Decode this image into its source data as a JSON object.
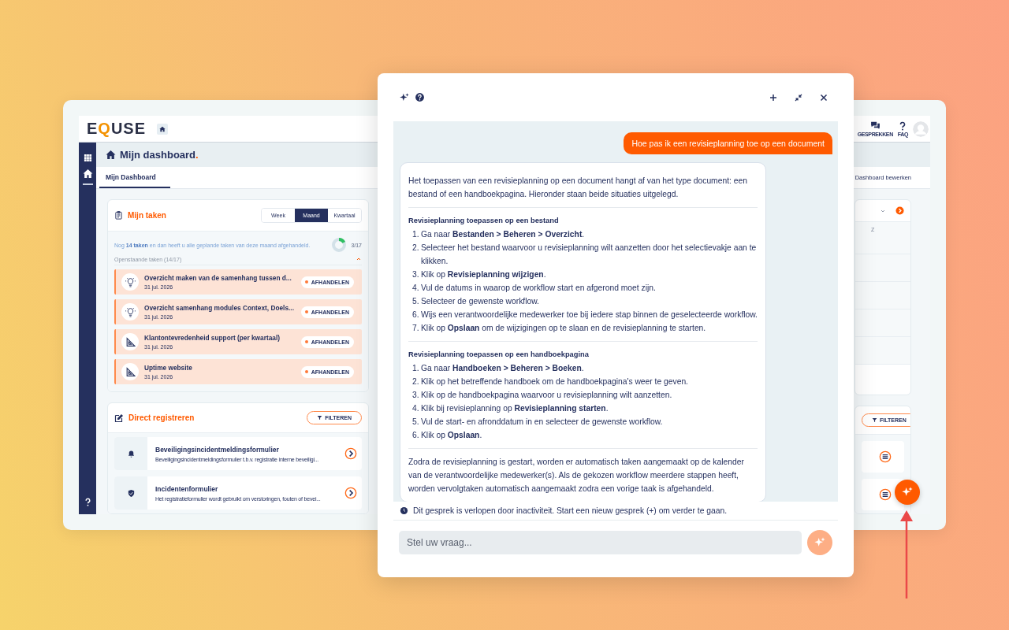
{
  "dashboard": {
    "logo": "EQUSE",
    "header_links": [
      {
        "kind": "chat",
        "label": "GESPREKKEN"
      },
      {
        "kind": "question",
        "label": "FAQ"
      }
    ],
    "page_title": {
      "text": "Mijn dashboard",
      "mark": "."
    },
    "tabs": [
      {
        "label": "Mijn Dashboard",
        "selected": true
      }
    ],
    "edit_link": "Dashboard bewerken",
    "tasks_card": {
      "title": "Mijn taken",
      "periods": [
        {
          "label": "Week",
          "selected": false
        },
        {
          "label": "Maand",
          "selected": true
        },
        {
          "label": "Kwartaal",
          "selected": false
        }
      ],
      "summary": "Nog **14 taken** en dan heeft u alle geplande taken van deze maand afgehandeld.",
      "progress": {
        "level": 0.176,
        "label": "3/17"
      },
      "open_tasks": {
        "label": "Openstaande taken (14/17)",
        "expanded": true
      },
      "tasks": [
        {
          "kind": "bulb",
          "title": "Overzicht maken van de samenhang tussen d...",
          "date": "31 jul. 2026",
          "action": "AFHANDELEN"
        },
        {
          "kind": "bulb",
          "title": "Overzicht samenhang modules Context, Doels...",
          "date": "31 jul. 2026",
          "action": "AFHANDELEN"
        },
        {
          "kind": "ruler",
          "title": "Klantontevredenheid support (per kwartaal)",
          "date": "31 jul. 2026",
          "action": "AFHANDELEN"
        },
        {
          "kind": "ruler",
          "title": "Uptime website",
          "date": "31 jul. 2026",
          "action": "AFHANDELEN"
        }
      ]
    },
    "register_card": {
      "title": "Direct registreren",
      "filter": "FILTEREN",
      "forms": [
        {
          "kind": "bell",
          "title": "Beveiligingsincidentmeldingsformulier",
          "description": "Beveiligingsincidentmeldingsformulier t.b.v. registratie interne beveiligi..."
        },
        {
          "kind": "shield",
          "title": "Incidentenformulier",
          "description": "Het registratieformulier wordt gebruikt om verstoringen, fouten of bevei..."
        }
      ]
    },
    "calendar_card": {
      "column_header": "Z"
    },
    "list_card": {
      "filter": "FILTEREN"
    }
  },
  "chat": {
    "user_message": "Hoe pas ik een revisieplanning toe op een document",
    "answer": [
      {
        "kind": "paragraph",
        "text": "Het toepassen van een revisieplanning op een document hangt af van het type document: een bestand of een handboekpagina. Hieronder staan beide situaties uitgelegd."
      },
      {
        "kind": "section",
        "heading": "Revisieplanning toepassen op een bestand",
        "steps": [
          {
            "number": "1.",
            "text": "Ga naar **Bestanden > Beheren > Overzicht**."
          },
          {
            "number": "2.",
            "text": "Selecteer het bestand waarvoor u revisieplanning wilt aanzetten door het selectievakje aan te klikken."
          },
          {
            "number": "3.",
            "text": "Klik op **Revisieplanning wijzigen**."
          },
          {
            "number": "4.",
            "text": "Vul de datums in waarop de workflow start en afgerond moet zijn."
          },
          {
            "number": "5.",
            "text": "Selecteer de gewenste workflow."
          },
          {
            "number": "6.",
            "text": "Wijs een verantwoordelijke medewerker toe bij iedere stap binnen de geselecteerde workflow."
          },
          {
            "number": "7.",
            "text": "Klik op **Opslaan** om de wijzigingen op te slaan en de revisieplanning te starten."
          }
        ]
      },
      {
        "kind": "section",
        "heading": "Revisieplanning toepassen op een handboekpagina",
        "steps": [
          {
            "number": "1.",
            "text": "Ga naar **Handboeken > Beheren > Boeken**."
          },
          {
            "number": "2.",
            "text": "Klik op het betreffende handboek om de handboekpagina's weer te geven."
          },
          {
            "number": "3.",
            "text": "Klik op de handboekpagina waarvoor u revisieplanning wilt aanzetten."
          },
          {
            "number": "4.",
            "text": "Klik bij revisieplanning op **Revisieplanning starten**."
          },
          {
            "number": "5.",
            "text": "Vul de start- en afronddatum in en selecteer de gewenste workflow."
          },
          {
            "number": "6.",
            "text": "Klik op **Opslaan**."
          }
        ]
      },
      {
        "kind": "paragraph",
        "text": "Zodra de revisieplanning is gestart, worden er automatisch taken aangemaakt op de kalender van de verantwoordelijke medewerker(s). Als de gekozen workflow meerdere stappen heeft, worden vervolgtaken automatisch aangemaakt zodra een vorige taak is afgehandeld."
      }
    ],
    "notice": "Dit gesprek is verlopen door inactiviteit. Start een nieuw gesprek (+) om verder te gaan.",
    "input": {
      "placeholder": "Stel uw vraag..."
    }
  }
}
